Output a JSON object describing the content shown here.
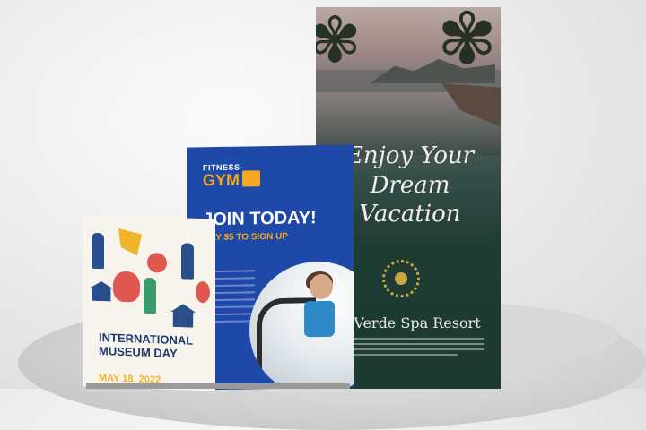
{
  "vacation_banner": {
    "headline": "Enjoy Your Dream Vacation",
    "brand": "Verde Spa Resort"
  },
  "gym_banner": {
    "logo_small": "FITNESS",
    "logo_main": "GYM",
    "headline": "JOIN TODAY!",
    "subline": "ONLY $5 TO SIGN UP"
  },
  "museum_banner": {
    "title": "INTERNATIONAL MUSEUM DAY",
    "date": "MAY 18, 2022"
  },
  "colors": {
    "gym_blue": "#1f49a8",
    "gym_orange": "#f5a623",
    "resort_green": "#1d3a32",
    "museum_navy": "#1e3a6b",
    "museum_yellow": "#f0b429"
  }
}
